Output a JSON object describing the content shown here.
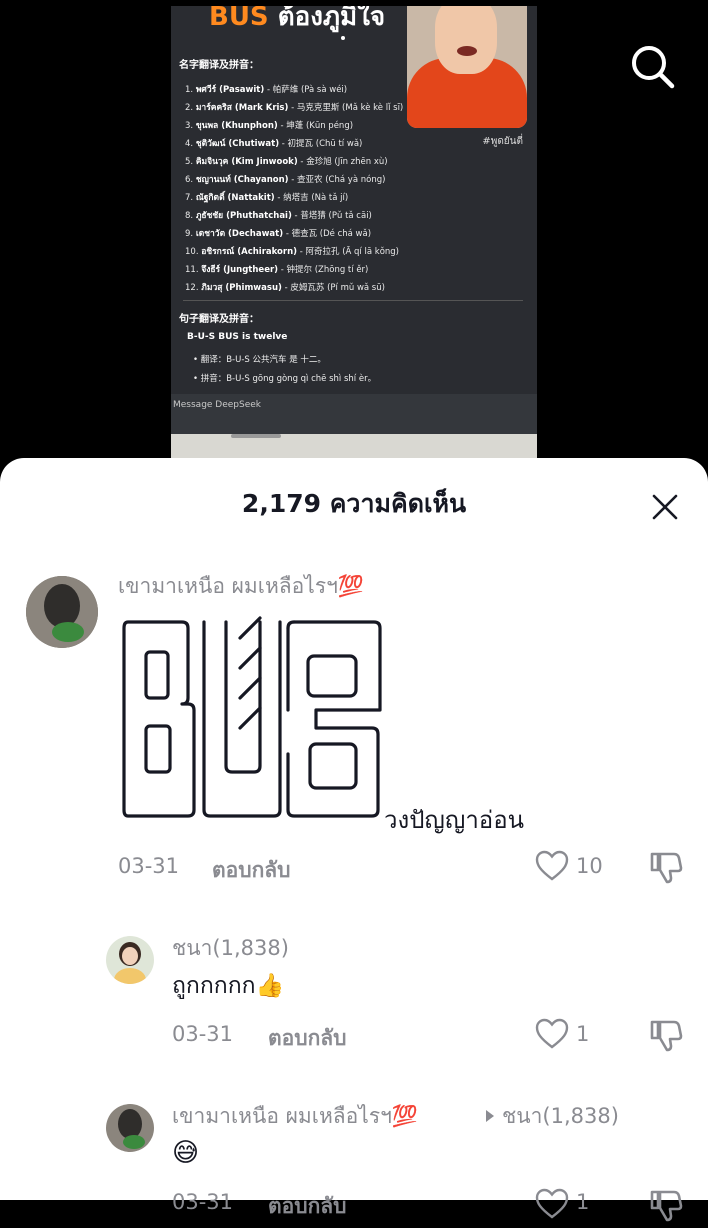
{
  "video": {
    "title_latin": "BUS",
    "title_thai": "ต้องภูมิใจ",
    "section_names": "名字翻译及拼音：",
    "names": [
      {
        "num": "1.",
        "thai": "พศวีร์ (Pasawit)",
        "rest": " - 帕萨维 (Pà sà wéi)"
      },
      {
        "num": "2.",
        "thai": "มาร์คคริส (Mark Kris)",
        "rest": " - 马克克里斯 (Mǎ kè kè lǐ sī)"
      },
      {
        "num": "3.",
        "thai": "ขุนพล (Khunphon)",
        "rest": " - 坤蓬 (Kūn péng)"
      },
      {
        "num": "4.",
        "thai": "ชุติวัฒน์ (Chutiwat)",
        "rest": " - 初提瓦 (Chū tí wǎ)"
      },
      {
        "num": "5.",
        "thai": "คิมจินวุค (Kim Jinwook)",
        "rest": " - 金珍旭 (Jīn zhēn xù)"
      },
      {
        "num": "6.",
        "thai": "ชญานนท์ (Chayanon)",
        "rest": " - 查亚农 (Chá yà nóng)"
      },
      {
        "num": "7.",
        "thai": "ณัฐกิตติ์ (Nattakit)",
        "rest": " - 纳塔吉 (Nà tǎ jí)"
      },
      {
        "num": "8.",
        "thai": "ภูธัชชัย (Phuthatchai)",
        "rest": " - 普塔猜 (Pǔ tǎ cāi)"
      },
      {
        "num": "9.",
        "thai": "เดชาวัต (Dechawat)",
        "rest": " - 德查瓦 (Dé chá wǎ)"
      },
      {
        "num": "10.",
        "thai": "อชิรกรณ์ (Achirakorn)",
        "rest": " - 阿奇拉孔 (Ā qí lā kǒng)"
      },
      {
        "num": "11.",
        "thai": "จึงธีร์ (Jungtheer)",
        "rest": " - 钟提尔 (Zhōng tí ěr)"
      },
      {
        "num": "12.",
        "thai": "ภิมวสุ (Phimwasu)",
        "rest": " - 皮姆瓦苏 (Pí mǔ wǎ sū)"
      }
    ],
    "section_sentence": "句子翻译及拼音：",
    "sentence": "B-U-S BUS is twelve",
    "bullet1": "• 翻译：B-U-S 公共汽车 是 十二。",
    "bullet2": "• 拼音：B-U-S gōng gòng qì chē shì shí èr。",
    "message_placeholder": "Message DeepSeek",
    "hashtag": "#พูดยันตี่"
  },
  "sheet": {
    "title": "2,179 ความคิดเห็น"
  },
  "comments": [
    {
      "username": "เขามาเหนือ ผมเหลือไรฯ💯",
      "art_caption": "วงปัญญาอ่อน",
      "date": "03-31",
      "reply_label": "ตอบกลับ",
      "likes": "10"
    },
    {
      "username": "ชนา(1,838)",
      "text": "ถูกกกกก👍",
      "date": "03-31",
      "reply_label": "ตอบกลับ",
      "likes": "1"
    },
    {
      "username": "เขามาเหนือ ผมเหลือไรฯ💯",
      "reply_to": "ชนา(1,838)",
      "text": "😅",
      "date": "03-31",
      "reply_label": "ตอบกลับ",
      "likes": "1"
    }
  ],
  "colors": {
    "sheet_bg": "#ffffff",
    "secondary_text": "#8a8b91",
    "primary_text": "#161823",
    "accent_orange": "#ff8a1f"
  }
}
